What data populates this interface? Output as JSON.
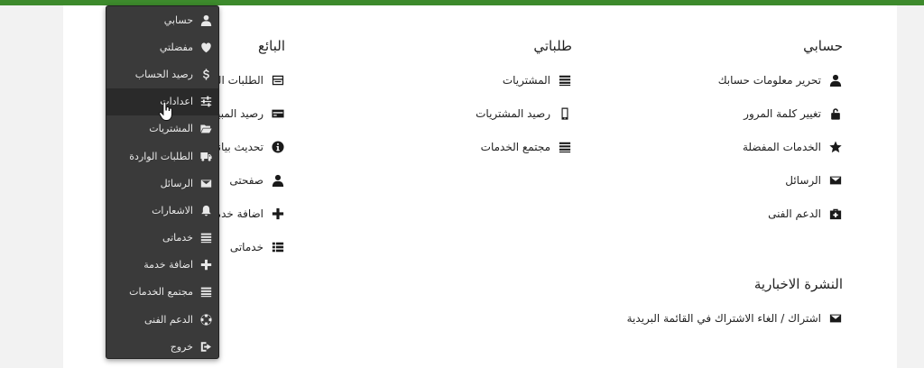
{
  "account": {
    "heading": "حسابي",
    "items": [
      {
        "label": "تحرير معلومات حسابك",
        "icon": "user-icon"
      },
      {
        "label": "تغيير كلمة المرور",
        "icon": "lock-icon"
      },
      {
        "label": "الخدمات المفضلة",
        "icon": "star-icon"
      },
      {
        "label": "الرسائل",
        "icon": "envelope-icon"
      },
      {
        "label": "الدعم الفنى",
        "icon": "medkit-icon"
      }
    ]
  },
  "orders": {
    "heading": "طلباتي",
    "items": [
      {
        "label": "المشتريات",
        "icon": "list-icon"
      },
      {
        "label": "رصيد المشتريات",
        "icon": "mobile-icon"
      },
      {
        "label": "مجتمع الخدمات",
        "icon": "list-icon"
      }
    ]
  },
  "seller": {
    "heading": "البائع",
    "items": [
      {
        "label": "الطلبات الواردة",
        "icon": "inbox-icon"
      },
      {
        "label": "رصيد المبيعات (الارباح",
        "icon": "credit-card-icon"
      },
      {
        "label": "تحديث بياناتى",
        "icon": "info-icon"
      },
      {
        "label": "صفحتى",
        "icon": "user-icon"
      },
      {
        "label": "اضافة خدمة",
        "icon": "plus-icon"
      },
      {
        "label": "خدماتى",
        "icon": "grid-list-icon"
      }
    ]
  },
  "newsletter": {
    "heading": "النشرة الاخبارية",
    "items": [
      {
        "label": "اشتراك / الغاء الاشتراك في القائمة البريدية",
        "icon": "envelope-icon"
      }
    ]
  },
  "dropdown": {
    "items": [
      {
        "label": "حسابي",
        "icon": "user-icon"
      },
      {
        "label": "مفضلتي",
        "icon": "heart-icon"
      },
      {
        "label": "رصيد الحساب",
        "icon": "dollar-icon"
      },
      {
        "label": "اعدادات",
        "icon": "sliders-icon"
      },
      {
        "label": "المشتريات",
        "icon": "folder-open-icon"
      },
      {
        "label": "الطلبات الواردة",
        "icon": "truck-icon"
      },
      {
        "label": "الرسائل",
        "icon": "envelope-icon"
      },
      {
        "label": "الاشعارات",
        "icon": "bell-icon"
      },
      {
        "label": "خدماتى",
        "icon": "list-icon"
      },
      {
        "label": "اضافة خدمة",
        "icon": "plus-icon"
      },
      {
        "label": "مجتمع الخدمات",
        "icon": "list-icon"
      },
      {
        "label": "الدعم الفنى",
        "icon": "life-ring-icon"
      },
      {
        "label": "خروج",
        "icon": "sign-out-icon"
      }
    ],
    "active_index": 3
  },
  "colors": {
    "top_bar": "#3d8a2c",
    "dropdown_bg": "#3a3a3a",
    "dropdown_active": "#2a2a2a"
  }
}
